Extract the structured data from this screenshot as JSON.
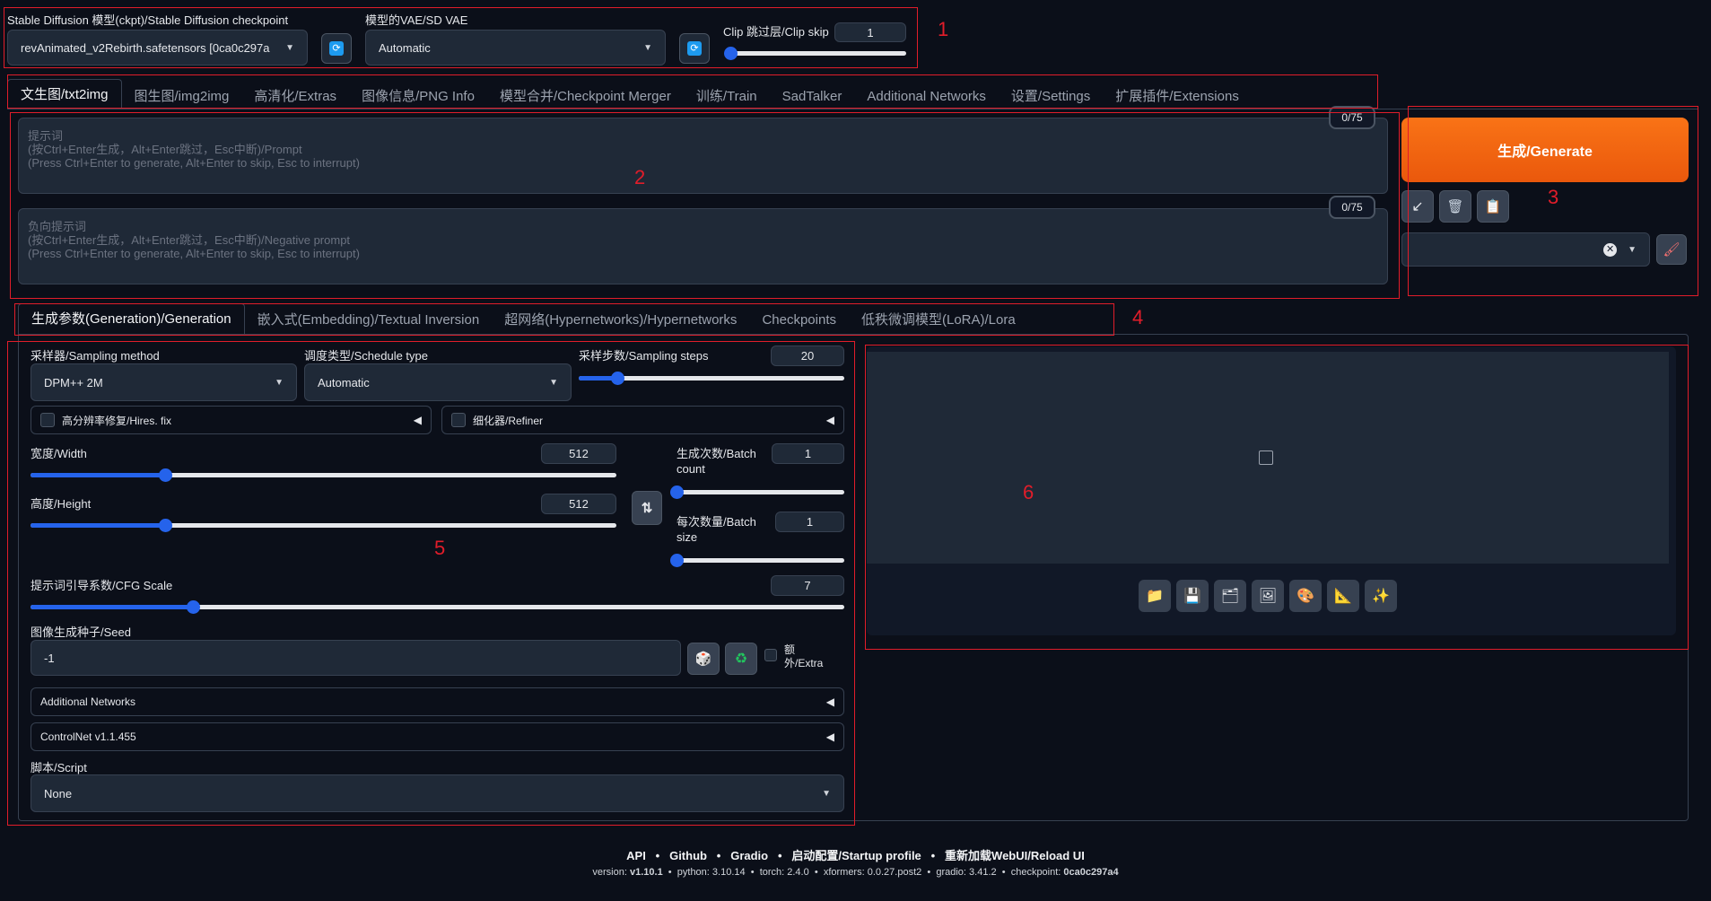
{
  "top": {
    "checkpoint_label": "Stable Diffusion 模型(ckpt)/Stable Diffusion checkpoint",
    "checkpoint_value": "revAnimated_v2Rebirth.safetensors [0ca0c297a",
    "vae_label": "模型的VAE/SD VAE",
    "vae_value": "Automatic",
    "clip_label": "Clip 跳过层/Clip skip",
    "clip_value": "1",
    "clip_fraction": 0.0
  },
  "main_tabs": [
    "文生图/txt2img",
    "图生图/img2img",
    "高清化/Extras",
    "图像信息/PNG Info",
    "模型合并/Checkpoint Merger",
    "训练/Train",
    "SadTalker",
    "Additional Networks",
    "设置/Settings",
    "扩展插件/Extensions"
  ],
  "prompt": {
    "placeholder_lines": [
      "提示词",
      "(按Ctrl+Enter生成，Alt+Enter跳过，Esc中断)/Prompt",
      "(Press Ctrl+Enter to generate, Alt+Enter to skip, Esc to interrupt)"
    ],
    "counter": "0/75"
  },
  "negative": {
    "placeholder_lines": [
      "负向提示词",
      "(按Ctrl+Enter生成，Alt+Enter跳过，Esc中断)/Negative prompt",
      "(Press Ctrl+Enter to generate, Alt+Enter to skip, Esc to interrupt)"
    ],
    "counter": "0/75"
  },
  "generate_label": "生成/Generate",
  "sub_tabs": [
    "生成参数(Generation)/Generation",
    "嵌入式(Embedding)/Textual Inversion",
    "超网络(Hypernetworks)/Hypernetworks",
    "Checkpoints",
    "低秩微调模型(LoRA)/Lora"
  ],
  "params": {
    "sampler_label": "采样器/Sampling method",
    "sampler_value": "DPM++ 2M",
    "schedule_label": "调度类型/Schedule type",
    "schedule_value": "Automatic",
    "steps_label": "采样步数/Sampling steps",
    "steps_value": "20",
    "steps_fraction": 0.146,
    "hires_label": "高分辨率修复/Hires. fix",
    "refiner_label": "细化器/Refiner",
    "width_label": "宽度/Width",
    "width_value": "512",
    "width_fraction": 0.23,
    "height_label": "高度/Height",
    "height_value": "512",
    "height_fraction": 0.23,
    "batch_count_label_1": "生成次数/Batch",
    "batch_count_label_2": "count",
    "batch_count_value": "1",
    "batch_count_fraction": 0.0,
    "batch_size_label_1": "每次数量/Batch",
    "batch_size_label_2": "size",
    "batch_size_value": "1",
    "batch_size_fraction": 0.0,
    "cfg_label": "提示词引导系数/CFG Scale",
    "cfg_value": "7",
    "cfg_fraction": 0.2,
    "seed_label": "图像生成种子/Seed",
    "seed_value": "-1",
    "extra_label_1": "额",
    "extra_label_2": "外/Extra",
    "addnet_label": "Additional Networks",
    "controlnet_label": "ControlNet v1.1.455",
    "script_label": "脚本/Script",
    "script_value": "None"
  },
  "annotations": [
    "1",
    "2",
    "3",
    "4",
    "5",
    "6"
  ],
  "footer": {
    "links": [
      "API",
      "Github",
      "Gradio",
      "启动配置/Startup profile",
      "重新加载WebUI/Reload UI"
    ],
    "version_prefix": "version:",
    "version": "v1.10.1",
    "python": "python: 3.10.14",
    "torch": "torch: 2.4.0",
    "xformers": "xformers: 0.0.27.post2",
    "gradio": "gradio: 3.41.2",
    "checkpoint_prefix": "checkpoint:",
    "checkpoint": "0ca0c297a4"
  },
  "colors": {
    "accent": "#2563eb",
    "generate": "#f97316",
    "annotation": "#e11d2a"
  }
}
